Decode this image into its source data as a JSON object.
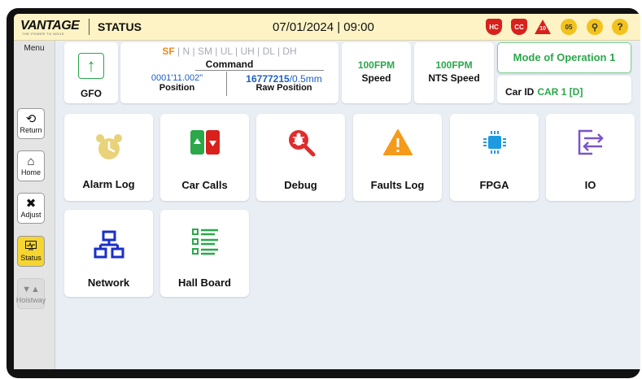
{
  "header": {
    "logo": "VANTAGE",
    "logo_tagline": "THE POWER TO MOVE",
    "title": "STATUS",
    "datetime": "07/01/2024 | 09:00",
    "alerts": [
      {
        "icon": "hc-shield-icon",
        "text": "HC",
        "color": "#d8211c"
      },
      {
        "icon": "cc-shield-icon",
        "text": "CC",
        "color": "#d8211c"
      },
      {
        "icon": "fault-triangle-icon",
        "text": "10",
        "color": "#d8211c"
      },
      {
        "icon": "alarm-clock-icon",
        "text": "05",
        "color": "#f3c21d"
      },
      {
        "icon": "search-icon",
        "text": "",
        "color": "#f3c21d"
      },
      {
        "icon": "help-icon",
        "text": "?",
        "color": "#f3c21d"
      }
    ]
  },
  "sidebar": {
    "menu_label": "Menu",
    "items": [
      {
        "label": "Return",
        "icon": "return-icon"
      },
      {
        "label": "Home",
        "icon": "home-icon"
      },
      {
        "label": "Adjust",
        "icon": "tools-icon"
      },
      {
        "label": "Status",
        "icon": "status-monitor-icon",
        "active": true
      },
      {
        "label": "Hoistway",
        "icon": "hoistway-icon",
        "disabled": true
      }
    ]
  },
  "status_bar": {
    "gfo_label": "GFO",
    "flags": [
      {
        "text": "SF",
        "active": true
      },
      {
        "text": "N",
        "active": false
      },
      {
        "text": "SM",
        "active": false
      },
      {
        "text": "UL",
        "active": false
      },
      {
        "text": "UH",
        "active": false
      },
      {
        "text": "DL",
        "active": false
      },
      {
        "text": "DH",
        "active": false
      }
    ],
    "command_label": "Command",
    "position_value": "0001'11.002\"",
    "position_label": "Position",
    "raw_position_value": "16777215",
    "raw_position_suffix": "/0.5mm",
    "raw_position_label": "Raw Position",
    "speed_value": "100FPM",
    "speed_label": "Speed",
    "nts_speed_value": "100FPM",
    "nts_speed_label": "NTS Speed",
    "mode": "Mode of Operation 1",
    "car_id_label": "Car ID",
    "car_id_value": "CAR 1 [D]"
  },
  "tiles": [
    {
      "label": "Alarm Log",
      "icon": "alarm-clock-icon"
    },
    {
      "label": "Car Calls",
      "icon": "car-calls-icon"
    },
    {
      "label": "Debug",
      "icon": "bug-search-icon"
    },
    {
      "label": "Faults Log",
      "icon": "warning-icon"
    },
    {
      "label": "FPGA",
      "icon": "chip-icon"
    },
    {
      "label": "IO",
      "icon": "io-icon"
    },
    {
      "label": "Network",
      "icon": "network-icon"
    },
    {
      "label": "Hall Board",
      "icon": "list-icon"
    }
  ]
}
